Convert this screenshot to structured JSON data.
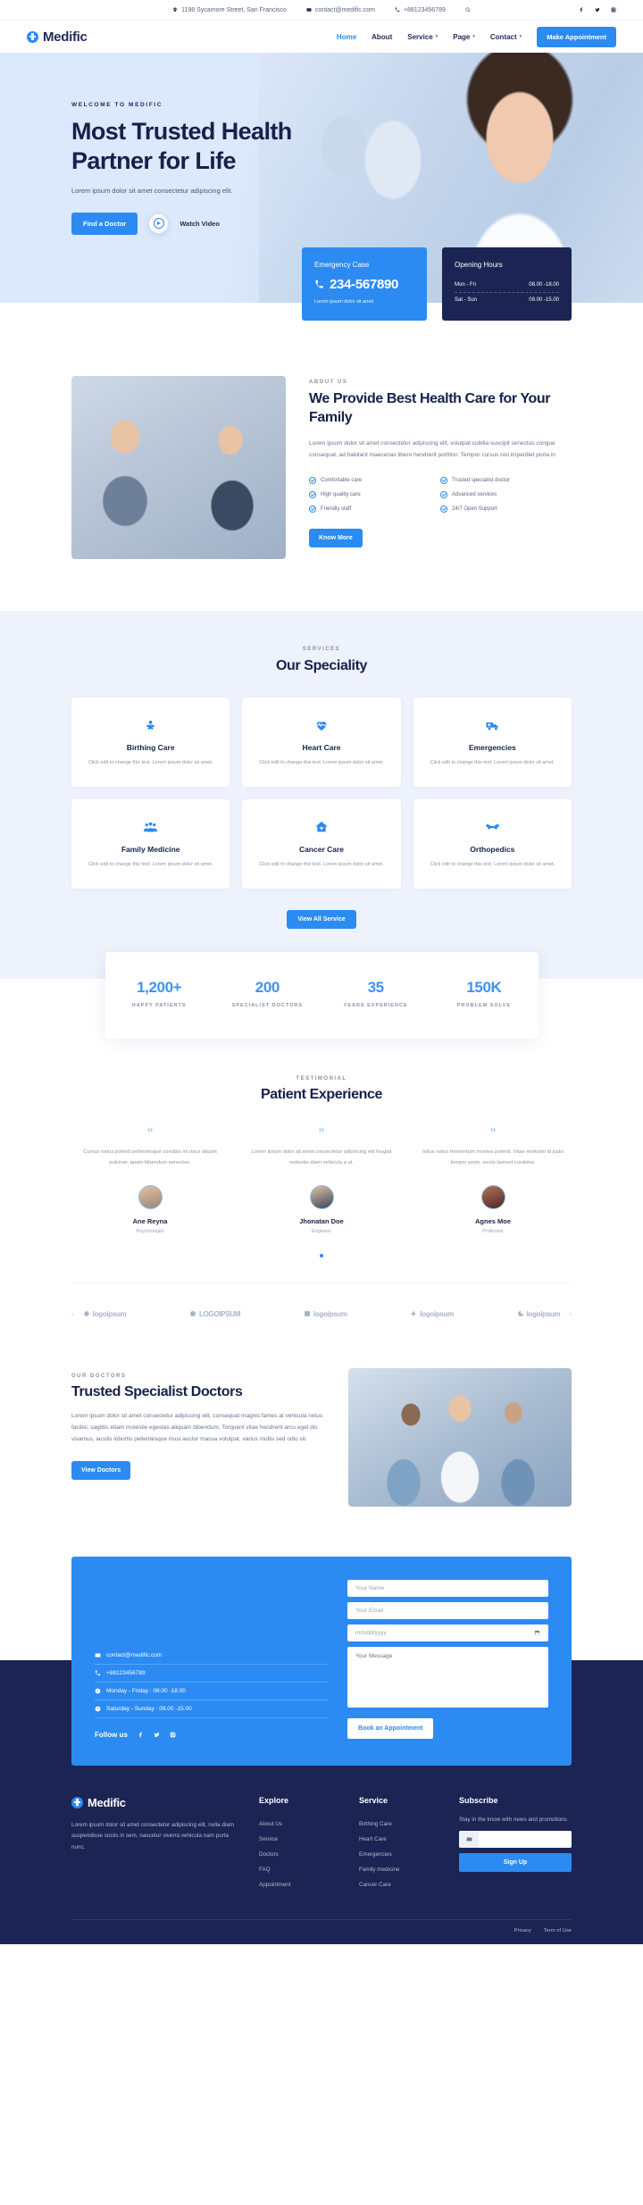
{
  "topbar": {
    "address": "1198 Sycamore Street, San Francisco",
    "email": "contact@medific.com",
    "phone": "+88123456789",
    "search_icon": "search-icon",
    "socials": [
      "facebook-icon",
      "twitter-icon",
      "instagram-icon"
    ]
  },
  "header": {
    "brand": "Medific",
    "nav": [
      {
        "label": "Home",
        "active": true,
        "caret": ""
      },
      {
        "label": "About",
        "active": false,
        "caret": ""
      },
      {
        "label": "Service",
        "active": false,
        "caret": "▾"
      },
      {
        "label": "Page",
        "active": false,
        "caret": "▾"
      },
      {
        "label": "Contact",
        "active": false,
        "caret": "▾"
      }
    ],
    "cta": "Make Appointment"
  },
  "hero": {
    "eyebrow": "WELCOME TO MEDIFIC",
    "title_line1": "Most Trusted Health",
    "title_line2": "Partner for Life",
    "desc": "Lorem ipsum dolor sit amet consectetur adipiscing elit.",
    "primary_btn": "Find a Doctor",
    "watch": "Watch Video"
  },
  "emergency": {
    "title": "Emergency Case",
    "phone": "234-567890",
    "sub": "Lorem ipsum dolor sit amet"
  },
  "opening": {
    "title": "Opening Hours",
    "rows": [
      {
        "day": "Mon - Fri",
        "time": "08.00 -18.00"
      },
      {
        "day": "Sat - Sun",
        "time": "09.00 -15.00"
      }
    ]
  },
  "about": {
    "eyebrow": "ABOUT US",
    "title": "We Provide Best Health Care for Your Family",
    "desc": "Lorem ipsum dolor sit amet consectetur adipiscing elit, volutpat cubilia suscipit senectus congue consequat, ad habitant maecenas libero hendrerit porttitor. Tempor cursus nisl imperdiet porta in",
    "features": [
      "Comfortable care",
      "Trusted specialist doctor",
      "High quality care",
      "Advanced services",
      "Friendly staff",
      "24/7 Open Support"
    ],
    "btn": "Know More"
  },
  "services": {
    "eyebrow": "SERVICES",
    "title": "Our Speciality",
    "items": [
      {
        "icon": "baby-icon",
        "title": "Birthing Care",
        "desc": "Click edit to change this text. Lorem ipsum dolor sit amet."
      },
      {
        "icon": "heart-pulse-icon",
        "title": "Heart Care",
        "desc": "Click edit to change this text. Lorem ipsum dolor sit amet."
      },
      {
        "icon": "ambulance-icon",
        "title": "Emergencies",
        "desc": "Click edit to change this text. Lorem ipsum dolor sit amet."
      },
      {
        "icon": "family-group-icon",
        "title": "Family Medicine",
        "desc": "Click edit to change this text. Lorem ipsum dolor sit amet."
      },
      {
        "icon": "hospital-home-icon",
        "title": "Cancer Care",
        "desc": "Click edit to change this text. Lorem ipsum dolor sit amet."
      },
      {
        "icon": "bone-icon",
        "title": "Orthopedics",
        "desc": "Click edit to change this text. Lorem ipsum dolor sit amet."
      }
    ],
    "btn": "View All Service"
  },
  "stats": [
    {
      "number": "1,200+",
      "label": "HAPPY PATIENTS"
    },
    {
      "number": "200",
      "label": "SPECIALIST DOCTORS"
    },
    {
      "number": "35",
      "label": "YEARS EXPERIENCE"
    },
    {
      "number": "150K",
      "label": "PROBLEM SOLVE"
    }
  ],
  "testimonial": {
    "eyebrow": "TESTIMONIAL",
    "title": "Patient Experience",
    "quote_mark": "”",
    "items": [
      {
        "text": "Cursus netus potenti pellentesque conubia mi risus aliquet pulvinar, quam bibendum senectus.",
        "name": "Ane Reyna",
        "role": "Psychologist"
      },
      {
        "text": "Lorem ipsum dolor sit amet consectetur adipiscing elit feugiat molestie diam vehicula a ut.",
        "name": "Jhonatan Doe",
        "role": "Engineer"
      },
      {
        "text": "tellus netus fermentum montes potenti. Vitae molestie id justo tempor proin, sociis laoreet curabitur.",
        "name": "Agnes Moe",
        "role": "Professor"
      }
    ]
  },
  "brands": {
    "prev": "‹",
    "next": "›",
    "items": [
      "logoipsum",
      "LOGOIPSUM",
      "logoipsum",
      "logoipsum",
      "logoipsum"
    ]
  },
  "doctors": {
    "eyebrow": "OUR DOCTORS",
    "title": "Trusted Specialist Doctors",
    "desc": "Lorem ipsum dolor sit amet consectetur adipiscing elit, consequat magnis fames at vehicula netus facilisi, sagittis etiam molestie egestas aliquam bibendum. Torquent vitae hendrerit arcu eget dis vivamus, iaculis lobortis pellentesque risus auctor massa volutpat, varius mollis sed odio sit.",
    "btn": "View Doctors"
  },
  "contact": {
    "email": "contact@medific.com",
    "phone": "+88123456789",
    "weekday": "Monday - Friday : 08.00 -18.00",
    "weekend": "Saturday - Sunday : 09.00 -15.00",
    "follow_label": "Follow us",
    "socials": [
      "facebook-icon",
      "twitter-icon",
      "instagram-icon"
    ],
    "name_placeholder": "Your Name",
    "email_placeholder": "Your Email",
    "date_placeholder": "mm/dd/yyyy",
    "message_placeholder": "Your Message",
    "submit": "Book an Appointment"
  },
  "footer": {
    "brand": "Medific",
    "about": "Lorem ipsum dolor sit amet consectetur adipiscing elit, nulla diam suspendisse sociis in sem, nascetur viverra vehicula nam porta nunc.",
    "explore_title": "Explore",
    "explore": [
      "About Us",
      "Service",
      "Doctors",
      "FAQ",
      "Appointment"
    ],
    "service_title": "Service",
    "service": [
      "Birthing Care",
      "Heart Care",
      "Emergencies",
      "Family medicine",
      "Cancer Care"
    ],
    "subscribe_title": "Subscribe",
    "subscribe_desc": "Stay in the know with news and promotions",
    "subscribe_value": "",
    "signup": "Sign Up",
    "privacy": "Privacy",
    "terms": "Term of Use"
  }
}
